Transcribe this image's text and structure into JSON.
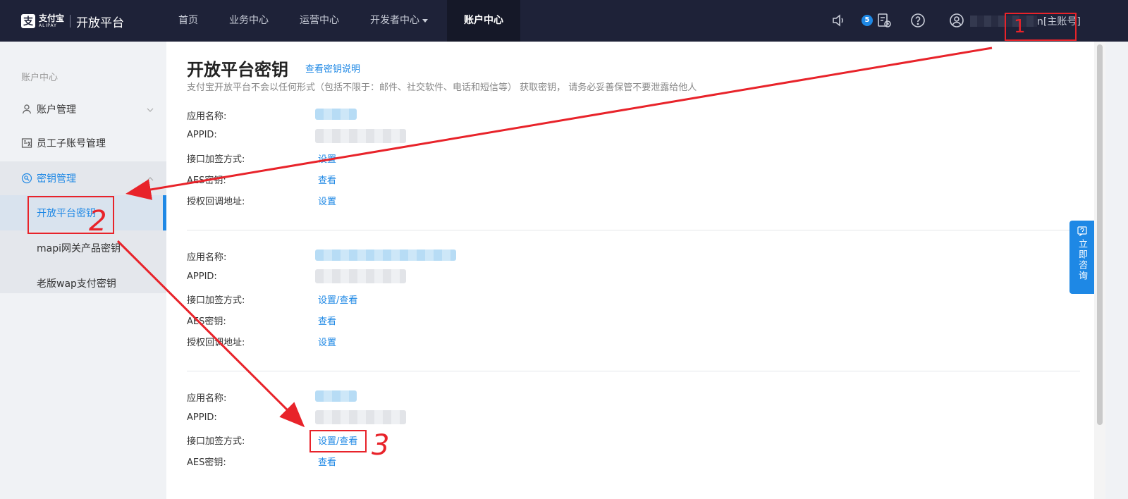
{
  "brand": {
    "logo_cn": "支付宝",
    "logo_en": "ALIPAY",
    "platform": "开放平台"
  },
  "nav": {
    "items": [
      "首页",
      "业务中心",
      "运营中心",
      "开发者中心",
      "账户中心"
    ],
    "active_index": 4
  },
  "topbar": {
    "notification_count": "5",
    "user_suffix": "n[主账号]"
  },
  "sidebar": {
    "title": "账户中心",
    "account_manage": "账户管理",
    "staff_manage": "员工子账号管理",
    "key_manage": "密钥管理",
    "sub_items": [
      "开放平台密钥",
      "mapi网关产品密钥",
      "老版wap支付密钥"
    ]
  },
  "main": {
    "title": "开放平台密钥",
    "title_link": "查看密钥说明",
    "description": "支付宝开放平台不会以任何形式（包括不限于：邮件、社交软件、电话和短信等） 获取密钥， 请务必妥善保管不要泄露给他人",
    "labels": {
      "app_name": "应用名称:",
      "appid": "APPID:",
      "sign_method": "接口加签方式:",
      "aes_key": "AES密钥:",
      "auth_callback": "授权回调地址:"
    },
    "apps": [
      {
        "sign_value": "设置",
        "aes_value": "查看",
        "callback_value": "设置"
      },
      {
        "sign_value": "设置/查看",
        "aes_value": "查看",
        "callback_value": "设置"
      },
      {
        "sign_value": "设置/查看",
        "aes_value": "查看"
      }
    ]
  },
  "consult": {
    "label": "立即咨询"
  },
  "annotations": {
    "marks": [
      "1",
      "2",
      "3"
    ],
    "color": "#e8232a"
  },
  "colors": {
    "nav_bg": "#1e2238",
    "accent": "#1e88e5"
  }
}
